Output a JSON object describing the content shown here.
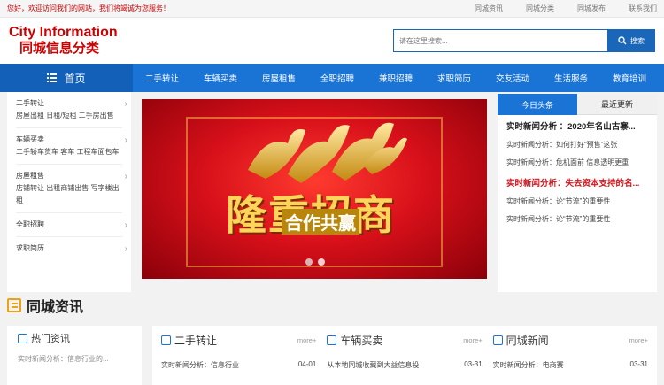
{
  "topbar": {
    "welcome": "您好，欢迎访问我们的网站，我们将竭诚为您服务！",
    "links": [
      "同城资讯",
      "同城分类",
      "同城发布",
      "联系我们"
    ]
  },
  "logo": {
    "en": "City Information",
    "cn": "同城信息分类"
  },
  "search": {
    "placeholder": "请在这里搜索...",
    "button": "搜索"
  },
  "nav": {
    "home": "首页",
    "items": [
      "二手转让",
      "车辆买卖",
      "房屋租售",
      "全职招聘",
      "兼职招聘",
      "求职简历",
      "交友活动",
      "生活服务",
      "教育培训"
    ]
  },
  "sidebar": {
    "groups": [
      {
        "title": "二手转让",
        "sub": "房屋出租 日租/短租 二手房出售"
      },
      {
        "title": "车辆买卖",
        "sub": "二手轿车货车 客车 工程车面包车"
      },
      {
        "title": "房屋租售",
        "sub": "店铺转让 出租商铺出售 写字楼出租"
      },
      {
        "title": "全职招聘",
        "sub": ""
      },
      {
        "title": "求职简历",
        "sub": ""
      }
    ]
  },
  "banner": {
    "title": "隆重招商",
    "subtitle": "合作共赢"
  },
  "news": {
    "tabs": [
      "今日头条",
      "最近更新"
    ],
    "blocks": [
      {
        "head": "实时新闻分析 ：2020年名山古寨...",
        "lines": [
          "实时新闻分析：如何打好“预售”这张",
          "实时新闻分析：危机面前 信息透明更重"
        ]
      },
      {
        "head": "实时新闻分析：失去资本支持的名...",
        "lines": [
          "实时新闻分析：论“节流”的重要性",
          "实时新闻分析：论“节流”的重要性"
        ]
      }
    ]
  },
  "section": {
    "title": "同城资讯"
  },
  "bottom": {
    "hot": {
      "title": "热门资讯",
      "rows": [
        "实时新闻分析：信息行业的..."
      ]
    },
    "cols": [
      {
        "name": "二手转让",
        "more": "more+",
        "row": {
          "text": "实时新闻分析：信息行业",
          "date": "04-01"
        }
      },
      {
        "name": "车辆买卖",
        "more": "more+",
        "row": {
          "text": "从本地同城收藏到大益信息投",
          "date": "03-31"
        }
      },
      {
        "name": "同城新闻",
        "more": "more+",
        "row": {
          "text": "实时新闻分析：电商赛",
          "date": "03-31"
        }
      }
    ]
  },
  "colors": {
    "accent": "#1a74d6",
    "red": "#d2141c"
  }
}
